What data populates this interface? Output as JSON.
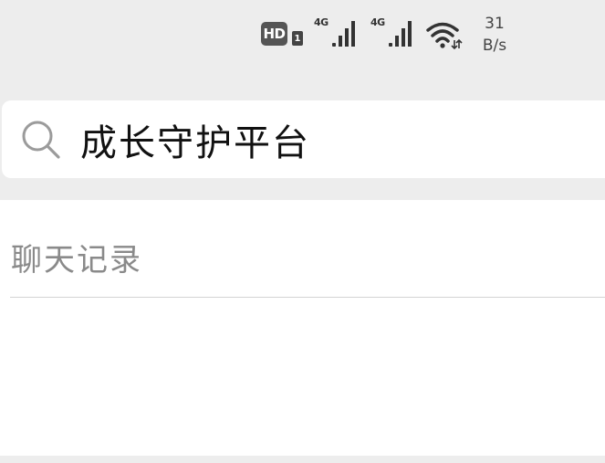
{
  "status_bar": {
    "hd_label": "HD",
    "sim_label": "1",
    "signals": [
      {
        "network": "4G"
      },
      {
        "network": "4G"
      }
    ],
    "speed_value": "31",
    "speed_unit": "B/s",
    "icons": [
      "hd-icon",
      "sim-icon",
      "signal-icon",
      "wifi-icon"
    ]
  },
  "search": {
    "query": "成长守护平台",
    "icon": "search-icon"
  },
  "results": {
    "section_title": "聊天记录"
  },
  "colors": {
    "background": "#ededed",
    "panel": "#ffffff",
    "secondary_text": "#8a8a8a",
    "primary_text": "#111111"
  }
}
